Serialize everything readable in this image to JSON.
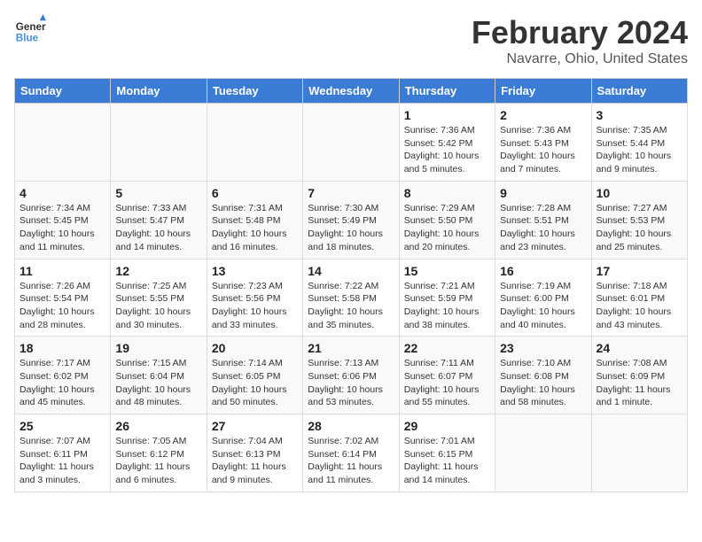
{
  "header": {
    "logo_line1": "General",
    "logo_line2": "Blue",
    "title": "February 2024",
    "subtitle": "Navarre, Ohio, United States"
  },
  "days_of_week": [
    "Sunday",
    "Monday",
    "Tuesday",
    "Wednesday",
    "Thursday",
    "Friday",
    "Saturday"
  ],
  "weeks": [
    [
      {
        "day": "",
        "info": ""
      },
      {
        "day": "",
        "info": ""
      },
      {
        "day": "",
        "info": ""
      },
      {
        "day": "",
        "info": ""
      },
      {
        "day": "1",
        "info": "Sunrise: 7:36 AM\nSunset: 5:42 PM\nDaylight: 10 hours\nand 5 minutes."
      },
      {
        "day": "2",
        "info": "Sunrise: 7:36 AM\nSunset: 5:43 PM\nDaylight: 10 hours\nand 7 minutes."
      },
      {
        "day": "3",
        "info": "Sunrise: 7:35 AM\nSunset: 5:44 PM\nDaylight: 10 hours\nand 9 minutes."
      }
    ],
    [
      {
        "day": "4",
        "info": "Sunrise: 7:34 AM\nSunset: 5:45 PM\nDaylight: 10 hours\nand 11 minutes."
      },
      {
        "day": "5",
        "info": "Sunrise: 7:33 AM\nSunset: 5:47 PM\nDaylight: 10 hours\nand 14 minutes."
      },
      {
        "day": "6",
        "info": "Sunrise: 7:31 AM\nSunset: 5:48 PM\nDaylight: 10 hours\nand 16 minutes."
      },
      {
        "day": "7",
        "info": "Sunrise: 7:30 AM\nSunset: 5:49 PM\nDaylight: 10 hours\nand 18 minutes."
      },
      {
        "day": "8",
        "info": "Sunrise: 7:29 AM\nSunset: 5:50 PM\nDaylight: 10 hours\nand 20 minutes."
      },
      {
        "day": "9",
        "info": "Sunrise: 7:28 AM\nSunset: 5:51 PM\nDaylight: 10 hours\nand 23 minutes."
      },
      {
        "day": "10",
        "info": "Sunrise: 7:27 AM\nSunset: 5:53 PM\nDaylight: 10 hours\nand 25 minutes."
      }
    ],
    [
      {
        "day": "11",
        "info": "Sunrise: 7:26 AM\nSunset: 5:54 PM\nDaylight: 10 hours\nand 28 minutes."
      },
      {
        "day": "12",
        "info": "Sunrise: 7:25 AM\nSunset: 5:55 PM\nDaylight: 10 hours\nand 30 minutes."
      },
      {
        "day": "13",
        "info": "Sunrise: 7:23 AM\nSunset: 5:56 PM\nDaylight: 10 hours\nand 33 minutes."
      },
      {
        "day": "14",
        "info": "Sunrise: 7:22 AM\nSunset: 5:58 PM\nDaylight: 10 hours\nand 35 minutes."
      },
      {
        "day": "15",
        "info": "Sunrise: 7:21 AM\nSunset: 5:59 PM\nDaylight: 10 hours\nand 38 minutes."
      },
      {
        "day": "16",
        "info": "Sunrise: 7:19 AM\nSunset: 6:00 PM\nDaylight: 10 hours\nand 40 minutes."
      },
      {
        "day": "17",
        "info": "Sunrise: 7:18 AM\nSunset: 6:01 PM\nDaylight: 10 hours\nand 43 minutes."
      }
    ],
    [
      {
        "day": "18",
        "info": "Sunrise: 7:17 AM\nSunset: 6:02 PM\nDaylight: 10 hours\nand 45 minutes."
      },
      {
        "day": "19",
        "info": "Sunrise: 7:15 AM\nSunset: 6:04 PM\nDaylight: 10 hours\nand 48 minutes."
      },
      {
        "day": "20",
        "info": "Sunrise: 7:14 AM\nSunset: 6:05 PM\nDaylight: 10 hours\nand 50 minutes."
      },
      {
        "day": "21",
        "info": "Sunrise: 7:13 AM\nSunset: 6:06 PM\nDaylight: 10 hours\nand 53 minutes."
      },
      {
        "day": "22",
        "info": "Sunrise: 7:11 AM\nSunset: 6:07 PM\nDaylight: 10 hours\nand 55 minutes."
      },
      {
        "day": "23",
        "info": "Sunrise: 7:10 AM\nSunset: 6:08 PM\nDaylight: 10 hours\nand 58 minutes."
      },
      {
        "day": "24",
        "info": "Sunrise: 7:08 AM\nSunset: 6:09 PM\nDaylight: 11 hours\nand 1 minute."
      }
    ],
    [
      {
        "day": "25",
        "info": "Sunrise: 7:07 AM\nSunset: 6:11 PM\nDaylight: 11 hours\nand 3 minutes."
      },
      {
        "day": "26",
        "info": "Sunrise: 7:05 AM\nSunset: 6:12 PM\nDaylight: 11 hours\nand 6 minutes."
      },
      {
        "day": "27",
        "info": "Sunrise: 7:04 AM\nSunset: 6:13 PM\nDaylight: 11 hours\nand 9 minutes."
      },
      {
        "day": "28",
        "info": "Sunrise: 7:02 AM\nSunset: 6:14 PM\nDaylight: 11 hours\nand 11 minutes."
      },
      {
        "day": "29",
        "info": "Sunrise: 7:01 AM\nSunset: 6:15 PM\nDaylight: 11 hours\nand 14 minutes."
      },
      {
        "day": "",
        "info": ""
      },
      {
        "day": "",
        "info": ""
      }
    ]
  ]
}
